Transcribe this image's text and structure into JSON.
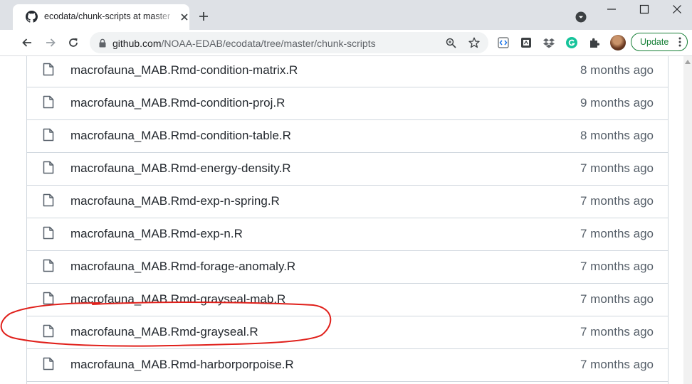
{
  "tab": {
    "title": "ecodata/chunk-scripts at master"
  },
  "omnibox": {
    "host": "github.com",
    "path": "/NOAA-EDAB/ecodata/tree/master/chunk-scripts"
  },
  "toolbar": {
    "update_label": "Update"
  },
  "colors": {
    "annotation": "#e0201b",
    "update_green": "#188038",
    "link_text": "#24292f",
    "muted_text": "#57606a"
  },
  "files": [
    {
      "name": "macrofauna_MAB.Rmd-condition-matrix.R",
      "age": "8 months ago"
    },
    {
      "name": "macrofauna_MAB.Rmd-condition-proj.R",
      "age": "9 months ago"
    },
    {
      "name": "macrofauna_MAB.Rmd-condition-table.R",
      "age": "8 months ago"
    },
    {
      "name": "macrofauna_MAB.Rmd-energy-density.R",
      "age": "7 months ago"
    },
    {
      "name": "macrofauna_MAB.Rmd-exp-n-spring.R",
      "age": "7 months ago"
    },
    {
      "name": "macrofauna_MAB.Rmd-exp-n.R",
      "age": "7 months ago"
    },
    {
      "name": "macrofauna_MAB.Rmd-forage-anomaly.R",
      "age": "7 months ago"
    },
    {
      "name": "macrofauna_MAB.Rmd-grayseal-mab.R",
      "age": "7 months ago"
    },
    {
      "name": "macrofauna_MAB.Rmd-grayseal.R",
      "age": "7 months ago"
    },
    {
      "name": "macrofauna_MAB.Rmd-harborporpoise.R",
      "age": "7 months ago"
    }
  ]
}
